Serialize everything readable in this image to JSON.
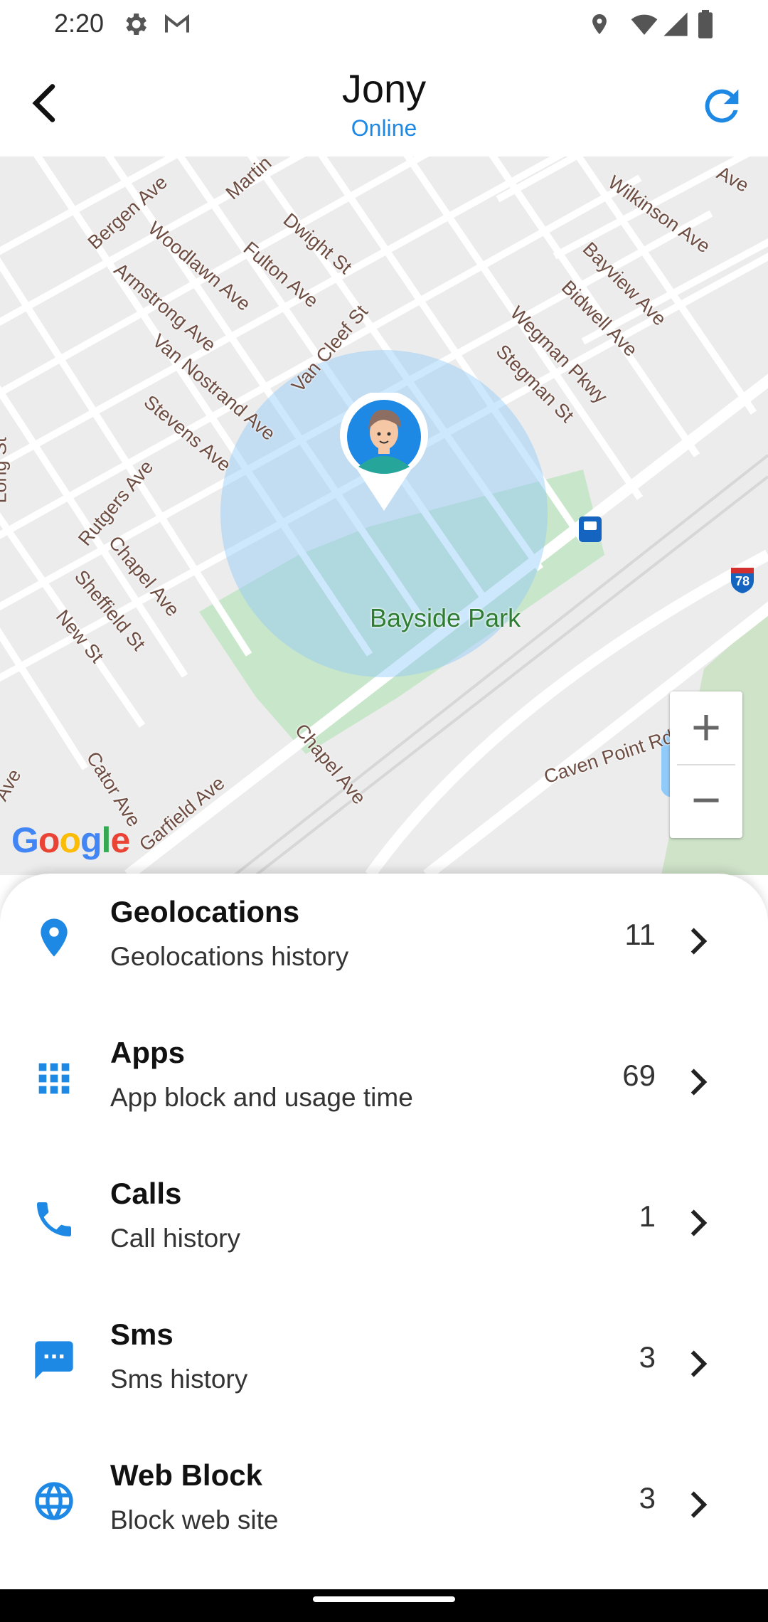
{
  "status_bar": {
    "time": "2:20"
  },
  "header": {
    "title": "Jony",
    "status": "Online"
  },
  "map": {
    "streets": [
      "Bergen Ave",
      "Martin",
      "Dwight St",
      "Woodlawn Ave",
      "Fulton Ave",
      "Armstrong Ave",
      "Van Cleef St",
      "Van Nostrand Ave",
      "Stevens Ave",
      "Long St",
      "Rutgers Ave",
      "Chapel Ave",
      "Sheffield St",
      "New St",
      "Wilkinson Ave",
      "Bayview Ave",
      "Bidwell Ave",
      "Wegman Pkwy",
      "Stegman St",
      "Cator Ave",
      "Garfield Ave",
      "Chapel Ave",
      "Caven Point Rd",
      "Ave",
      "Ave"
    ],
    "park": "Bayside Park",
    "highway_shield": "78",
    "attribution": [
      "G",
      "o",
      "o",
      "g",
      "l",
      "e"
    ],
    "zoom_in": "+",
    "zoom_out": "−"
  },
  "menu": {
    "items": [
      {
        "label": "Geolocations",
        "sub": "Geolocations history",
        "count": "11",
        "icon": "location-pin-icon"
      },
      {
        "label": "Apps",
        "sub": "App block and usage time",
        "count": "69",
        "icon": "apps-grid-icon"
      },
      {
        "label": "Calls",
        "sub": "Call history",
        "count": "1",
        "icon": "phone-icon"
      },
      {
        "label": "Sms",
        "sub": "Sms history",
        "count": "3",
        "icon": "message-icon"
      },
      {
        "label": "Web Block",
        "sub": "Block web site",
        "count": "3",
        "icon": "globe-icon"
      }
    ]
  },
  "colors": {
    "accent": "#1e88e5",
    "park": "#c8e6c9",
    "radius": "#90caf9"
  }
}
